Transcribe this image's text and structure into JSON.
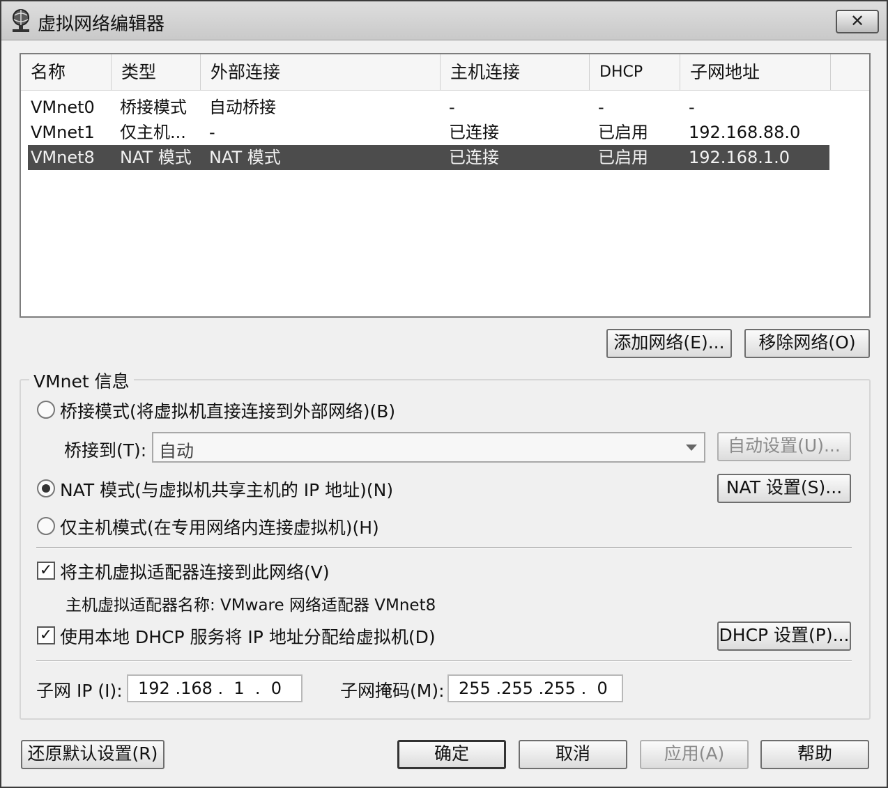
{
  "window": {
    "title": "虚拟网络编辑器",
    "close_label": "✕"
  },
  "list": {
    "columns": [
      "名称",
      "类型",
      "外部连接",
      "主机连接",
      "DHCP",
      "子网地址"
    ],
    "rows": [
      {
        "name": "VMnet0",
        "type": "桥接模式",
        "external": "自动桥接",
        "host": "-",
        "dhcp": "-",
        "subnet": "-"
      },
      {
        "name": "VMnet1",
        "type": "仅主机...",
        "external": "-",
        "host": "已连接",
        "dhcp": "已启用",
        "subnet": "192.168.88.0"
      },
      {
        "name": "VMnet8",
        "type": "NAT 模式",
        "external": "NAT 模式",
        "host": "已连接",
        "dhcp": "已启用",
        "subnet": "192.168.1.0",
        "selected": true
      }
    ]
  },
  "buttons": {
    "add_network": "添加网络(E)...",
    "remove_network": "移除网络(O)",
    "auto_settings": "自动设置(U)...",
    "nat_settings": "NAT 设置(S)...",
    "dhcp_settings": "DHCP 设置(P)...",
    "restore_defaults": "还原默认设置(R)",
    "ok": "确定",
    "cancel": "取消",
    "apply": "应用(A)",
    "help": "帮助"
  },
  "vmnet_info": {
    "group_title": "VMnet 信息",
    "bridged_label": "桥接模式(将虚拟机直接连接到外部网络)(B)",
    "bridged_to_label": "桥接到(T):",
    "bridged_to_value": "自动",
    "nat_label": "NAT 模式(与虚拟机共享主机的 IP 地址)(N)",
    "hostonly_label": "仅主机模式(在专用网络内连接虚拟机)(H)",
    "selected_mode": "nat",
    "connect_adapter_label": "将主机虚拟适配器连接到此网络(V)",
    "connect_adapter_checked": true,
    "adapter_name_text": "主机虚拟适配器名称: VMware 网络适配器 VMnet8",
    "use_dhcp_label": "使用本地 DHCP 服务将 IP 地址分配给虚拟机(D)",
    "use_dhcp_checked": true,
    "subnet_ip_label": "子网 IP (I):",
    "subnet_ip_value": "192 .168 .  1  .  0",
    "subnet_mask_label": "子网掩码(M):",
    "subnet_mask_value": "255 .255 .255 .  0"
  },
  "icons": {
    "app": "network-globe-icon",
    "check": "✓"
  }
}
